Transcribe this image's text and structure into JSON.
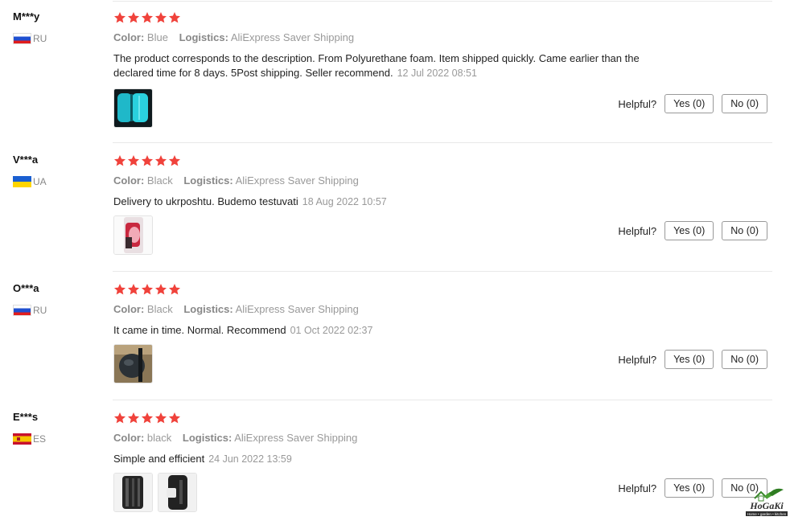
{
  "colors": {
    "star": "#f0423b",
    "muted": "#999999",
    "border": "#e8e8e8"
  },
  "labels": {
    "color": "Color:",
    "logistics": "Logistics:",
    "helpful": "Helpful?"
  },
  "reviews": [
    {
      "user": "M***y",
      "flag": "flag-ru",
      "country": "RU",
      "rating": 5,
      "color_value": "Blue",
      "logistics_value": "AliExpress Saver Shipping",
      "text": "The product corresponds to the description. From Polyurethane foam. Item shipped quickly. Came earlier than the declared time for 8 days. 5Post shipping. Seller recommend.",
      "date": "12 Jul 2022 08:51",
      "yes": "Yes (0)",
      "no": "No (0)"
    },
    {
      "user": "V***a",
      "flag": "flag-ua",
      "country": "UA",
      "rating": 5,
      "color_value": "Black",
      "logistics_value": "AliExpress Saver Shipping",
      "text": "Delivery to ukrposhtu. Budemo testuvati",
      "date": "18 Aug 2022 10:57",
      "yes": "Yes (0)",
      "no": "No (0)"
    },
    {
      "user": "O***a",
      "flag": "flag-ru",
      "country": "RU",
      "rating": 5,
      "color_value": "Black",
      "logistics_value": "AliExpress Saver Shipping",
      "text": "It came in time. Normal. Recommend",
      "date": "01 Oct 2022 02:37",
      "yes": "Yes (0)",
      "no": "No (0)"
    },
    {
      "user": "E***s",
      "flag": "flag-es",
      "country": "ES",
      "rating": 5,
      "color_value": "black",
      "logistics_value": "AliExpress Saver Shipping",
      "text": "Simple and efficient",
      "date": "24 Jun 2022 13:59",
      "yes": "Yes (0)",
      "no": "No (0)"
    }
  ],
  "watermark": {
    "brand": "HoGaKi",
    "tagline": "Home • garden • kitchen"
  }
}
